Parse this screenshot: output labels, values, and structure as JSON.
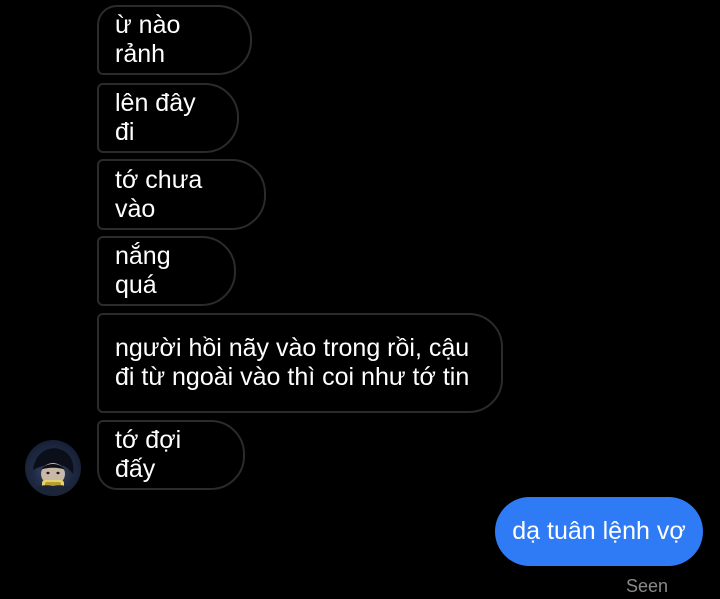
{
  "conversation": {
    "received": [
      {
        "text": "ừ nào rảnh"
      },
      {
        "text": "lên đây đi"
      },
      {
        "text": "tớ chưa vào"
      },
      {
        "text": "nắng quá"
      },
      {
        "text": "người hồi nãy vào trong rồi, cậu\nđi từ ngoài vào thì coi như tớ tin"
      },
      {
        "text": "tớ đợi đấy"
      }
    ],
    "sent": [
      {
        "text": "dạ tuân lệnh vợ"
      }
    ],
    "seen_label": "Seen"
  },
  "colors": {
    "background": "#000000",
    "received_border": "#2b2b2b",
    "sent_bubble": "#2f7bf6",
    "seen_text": "#8a8a8a"
  },
  "icons": {
    "avatar": "contact-avatar-photo"
  }
}
